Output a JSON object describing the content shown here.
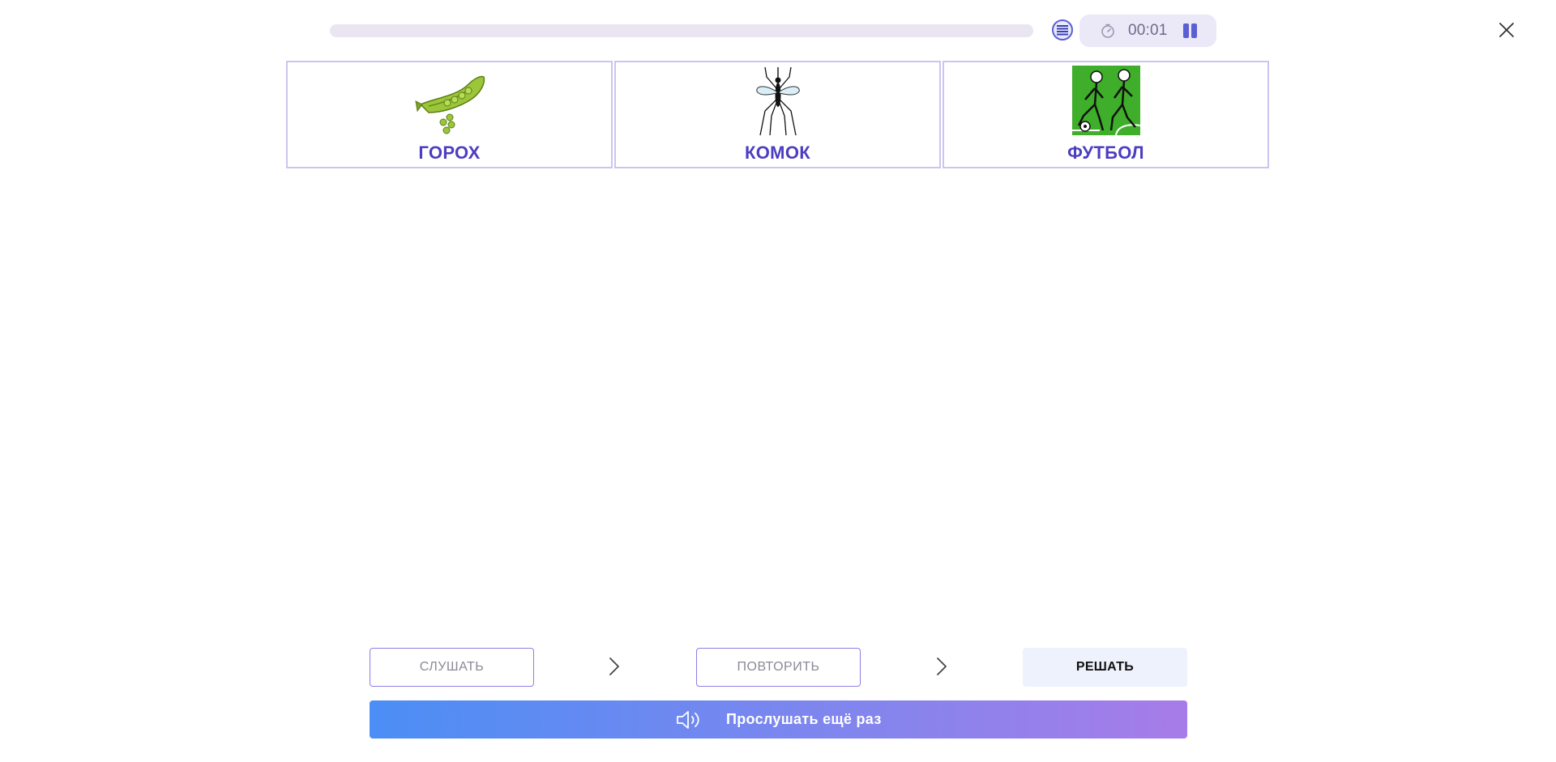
{
  "progress": {
    "value": 0
  },
  "timer": {
    "time": "00:01"
  },
  "cards": [
    {
      "word": "ГОРОХ",
      "image": "pea-pod-icon"
    },
    {
      "word": "КОМОК",
      "image": "mosquito-icon"
    },
    {
      "word": "ФУТБОЛ",
      "image": "football-players-icon"
    }
  ],
  "steps": {
    "listen_label": "СЛУШАТЬ",
    "repeat_label": "ПОВТОРИТЬ",
    "solve_label": "РЕШАТЬ"
  },
  "listen_again": {
    "label": "Прослушать ещё раз"
  },
  "colors": {
    "accent": "#4b3ec0",
    "button_gradient_start": "#4b8ef5",
    "button_gradient_end": "#a77ce8"
  }
}
